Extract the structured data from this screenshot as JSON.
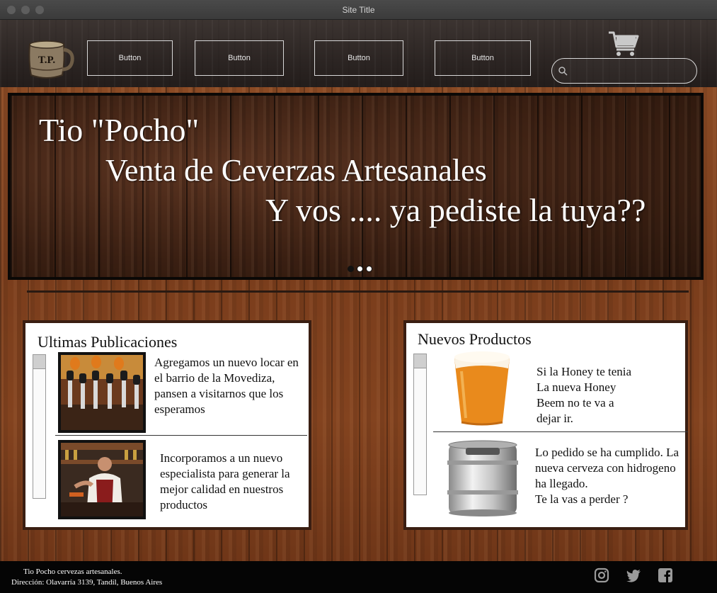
{
  "window": {
    "title": "Site Title"
  },
  "header": {
    "logo_text": "T.P.",
    "nav_buttons": [
      "Button",
      "Button",
      "Button",
      "Button"
    ],
    "search": {
      "placeholder": ""
    }
  },
  "hero": {
    "line1": "Tio \"Pocho\"",
    "line2": "Venta de Ceverzas Artesanales",
    "line3": "Y vos .... ya pediste la tuya??",
    "slides": 3,
    "active_slide": 1
  },
  "publicaciones": {
    "title": "Ultimas Publicaciones",
    "items": [
      {
        "text": "Agregamos un nuevo locar en el barrio de la Movediza, pansen a visitarnos que los esperamos",
        "image": "beer-taps-photo"
      },
      {
        "text": "Incorporamos a un nuevo especialista para generar la mejor calidad en nuestros productos",
        "image": "bartender-photo"
      }
    ]
  },
  "productos": {
    "title": "Nuevos Productos",
    "items": [
      {
        "text": "Si la Honey te tenia\n La nueva Honey\nBeem no te va a\ndejar ir.",
        "image": "beer-glass-photo"
      },
      {
        "text": "Lo pedido se ha cumplido. La nueva cerveza con hidrogeno ha llegado.\nTe la vas a perder ?",
        "image": "beer-keg-photo"
      }
    ]
  },
  "footer": {
    "line1": "Tio Pocho cervezas artesanales.",
    "line2": "Dirección: Olavarría 3139, Tandil, Buenos Aires",
    "social": [
      "instagram-icon",
      "twitter-icon",
      "facebook-icon"
    ]
  }
}
